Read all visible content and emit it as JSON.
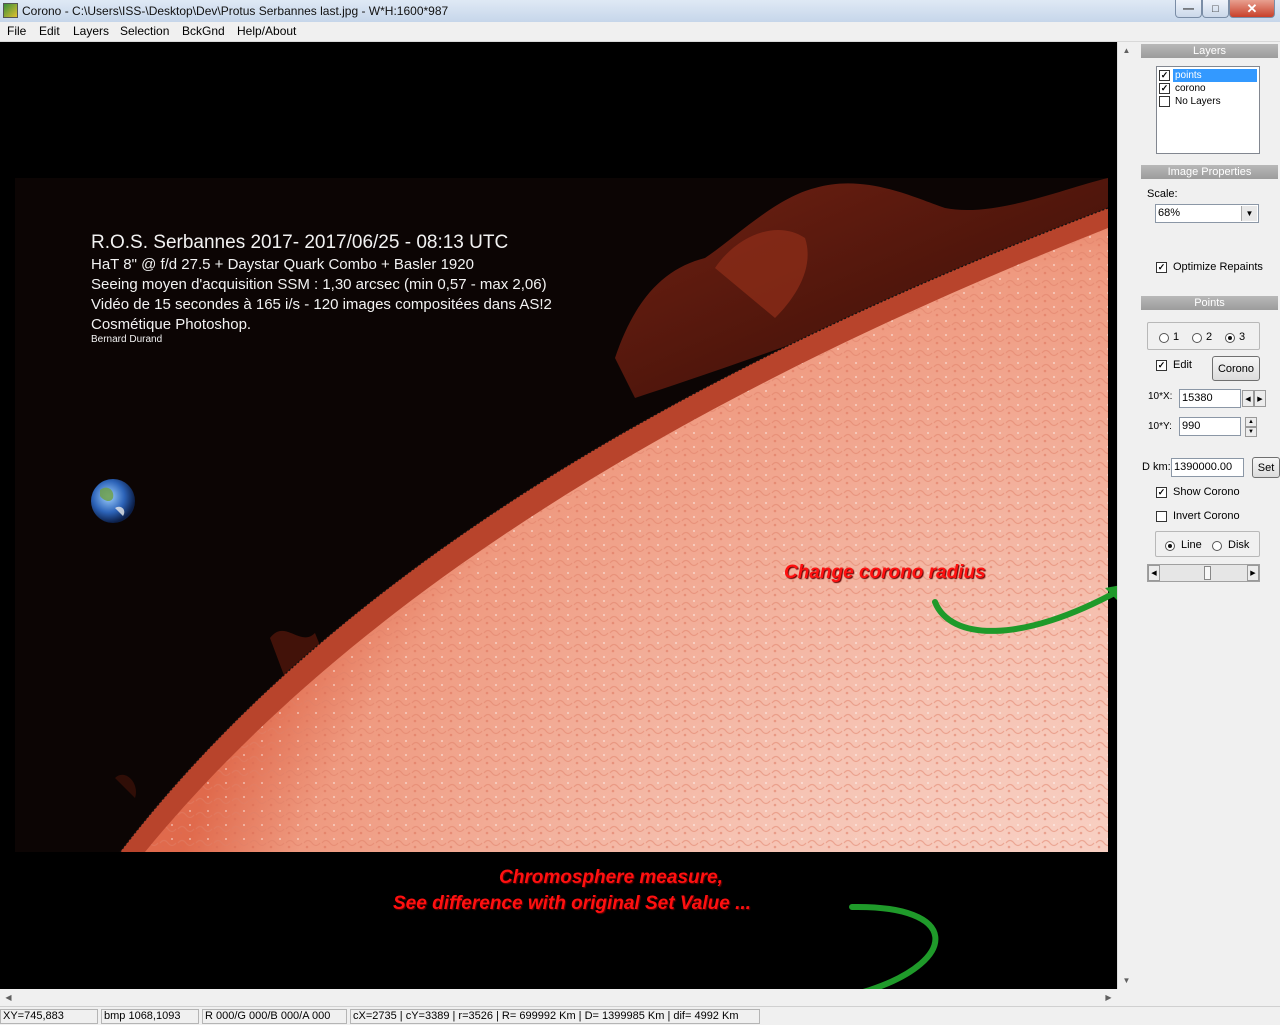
{
  "window": {
    "title": "Corono - C:\\Users\\ISS-\\Desktop\\Dev\\Protus Serbannes last.jpg - W*H:1600*987",
    "minimize_icon": "minimize-icon",
    "maximize_icon": "maximize-icon",
    "close_icon": "close-icon"
  },
  "menu": [
    "File",
    "Edit",
    "Layers",
    "Selection",
    "BckGnd",
    "Help/About"
  ],
  "image_overlay": {
    "title": "R.O.S. Serbannes 2017- 2017/06/25 - 08:13 UTC",
    "lines": [
      "HaT 8\" @ f/d 27.5 + Daystar Quark Combo + Basler 1920",
      "Seeing moyen d'acquisition SSM : 1,30 arcsec (min 0,57 - max 2,06)",
      "Vidéo de 15 secondes à 165 i/s - 120 images compositées dans AS!2",
      "Cosmétique Photoshop."
    ],
    "author": "Bernard Durand"
  },
  "panel": {
    "layers": {
      "header": "Layers",
      "items": [
        {
          "label": "points",
          "checked": true,
          "selected": true
        },
        {
          "label": "corono",
          "checked": true,
          "selected": false
        },
        {
          "label": "No Layers",
          "checked": false,
          "selected": false
        }
      ]
    },
    "image_properties": {
      "header": "Image Properties",
      "scale_label": "Scale:",
      "scale_value": "68%",
      "optimize_label": "Optimize Repaints",
      "optimize_checked": true
    },
    "points": {
      "header": "Points",
      "radios": [
        {
          "label": "1",
          "selected": false
        },
        {
          "label": "2",
          "selected": false
        },
        {
          "label": "3",
          "selected": true
        }
      ],
      "edit_label": "Edit",
      "edit_checked": true,
      "corono_button": "Corono",
      "x_label": "10*X:",
      "x_value": "15380",
      "y_label": "10*Y:",
      "y_value": "990",
      "d_label": "D km:",
      "d_value": "1390000.00",
      "set_button": "Set",
      "show_corono_label": "Show Corono",
      "show_corono_checked": true,
      "invert_corono_label": "Invert Corono",
      "invert_corono_checked": false,
      "line_label": "Line",
      "disk_label": "Disk",
      "mode_selected": "Line",
      "slider_level": 0.55
    }
  },
  "status": {
    "xy": "XY=745,883",
    "bmp": "bmp 1068,1093",
    "rgba": "R 000/G 000/B 000/A 000",
    "measure": "cX=2735 | cY=3389 | r=3526 | R= 699992 Km | D= 1399985 Km | dif= 4992 Km"
  },
  "annotations": {
    "radius": "Change corono radius",
    "measure_line1": "Chromosphere measure,",
    "measure_line2": "See difference with original Set Value ..."
  },
  "colors": {
    "annotation_red": "#ff1010",
    "arrow_green": "#1f9a2a",
    "selection_blue": "#3399ff"
  }
}
